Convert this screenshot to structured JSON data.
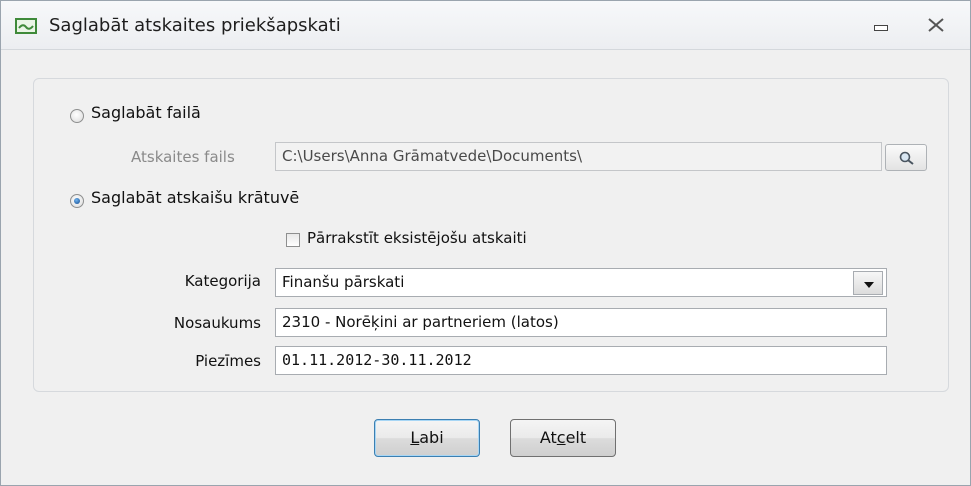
{
  "window": {
    "title": "Saglabāt atskaites priekšapskati"
  },
  "save_to_file": {
    "label": "Saglabāt failā",
    "selected": false,
    "file_label": "Atskaites fails",
    "file_value": "C:\\Users\\Anna Grāmatvede\\Documents\\"
  },
  "save_to_storage": {
    "label": "Saglabāt atskaišu krātuvē",
    "selected": true,
    "overwrite_label": "Pārrakstīt eksistējošu atskaiti",
    "overwrite_checked": false
  },
  "fields": {
    "category_label": "Kategorija",
    "category_value": "Finanšu pārskati",
    "name_label": "Nosaukums",
    "name_value": "2310 - Norēķini ar partneriem (latos)",
    "notes_label": "Piezīmes",
    "notes_value": "01.11.2012-30.11.2012"
  },
  "buttons": {
    "ok_mnemonic": "L",
    "ok_rest": "abi",
    "cancel_prefix": "At",
    "cancel_mnemonic": "c",
    "cancel_rest": "elt"
  },
  "icons": {
    "app": "app-window-icon",
    "minimize": "minimize-icon",
    "close": "close-icon",
    "browse": "magnifier-icon",
    "dropdown": "chevron-down-icon"
  }
}
